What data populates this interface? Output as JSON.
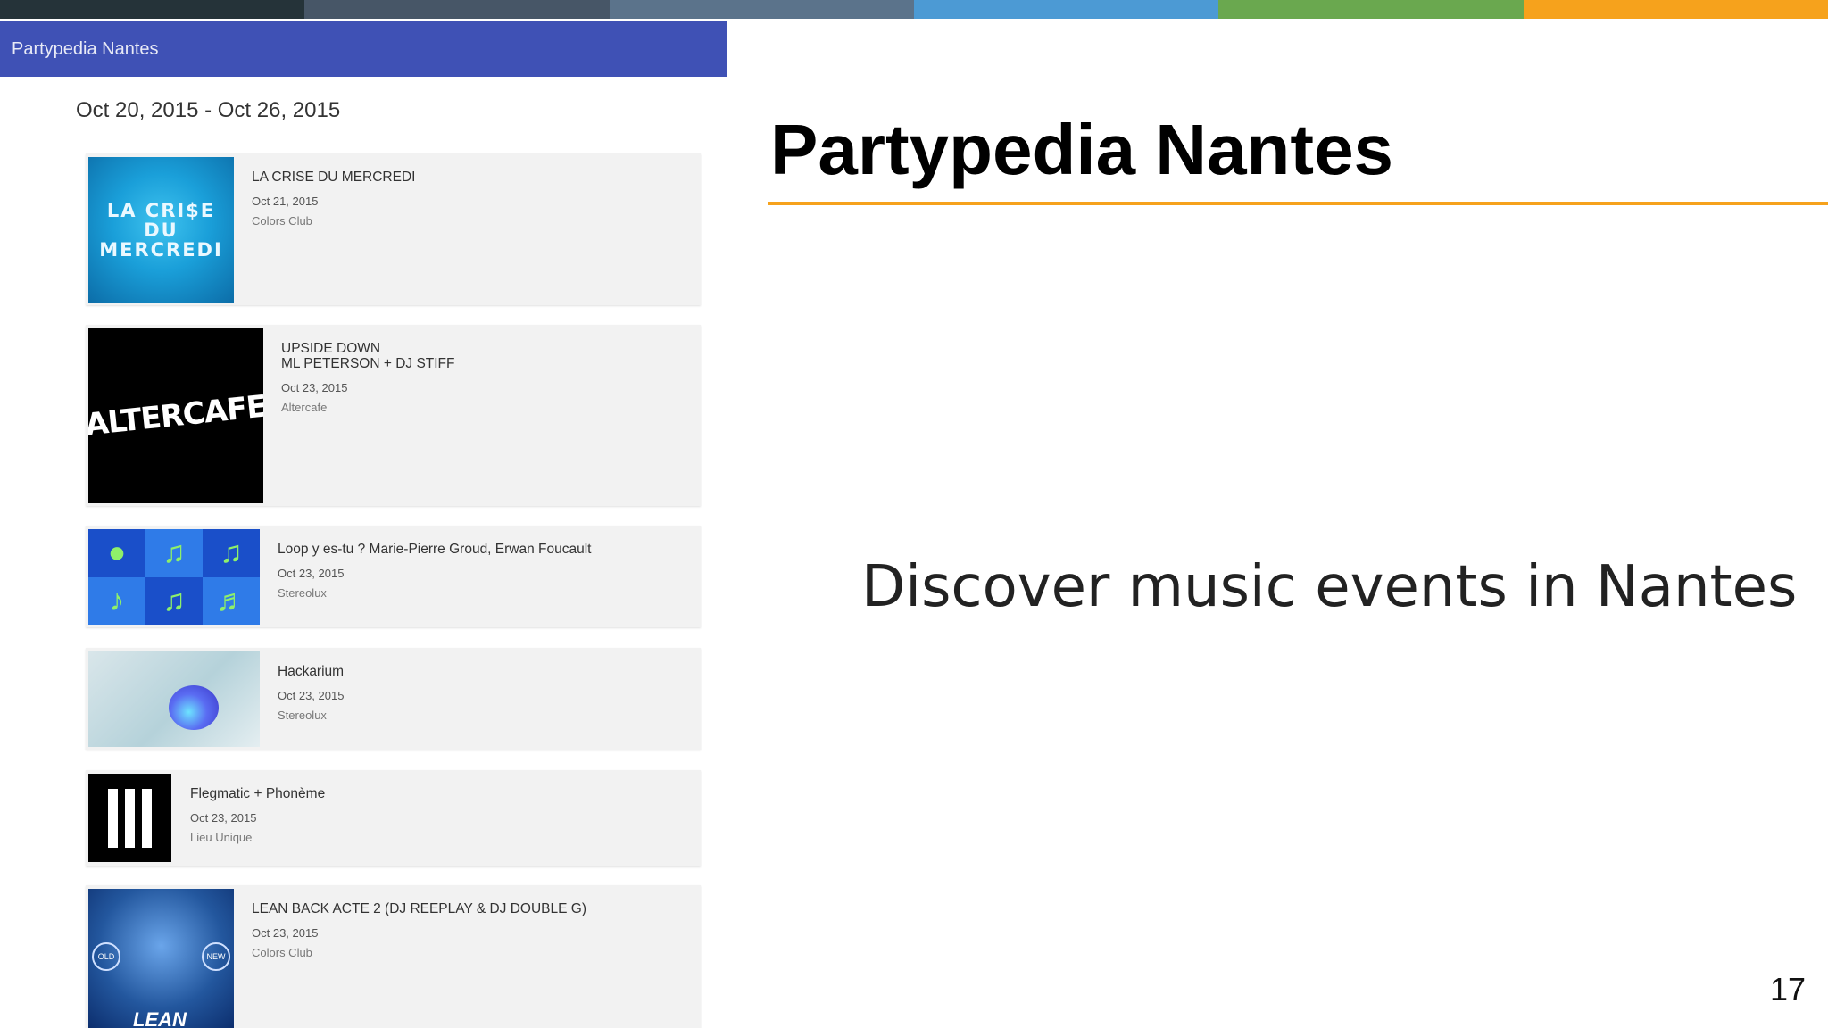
{
  "top_bar_colors": [
    "#253339",
    "#475667",
    "#5b738b",
    "#4c9ad4",
    "#6aa84f",
    "#f6a21c"
  ],
  "app": {
    "header_title": "Partypedia Nantes",
    "header_color": "#3f51b5",
    "date_range": "Oct 20, 2015 - Oct 26, 2015",
    "events": [
      {
        "title": "LA CRISE DU MERCREDI",
        "date": "Oct 21, 2015",
        "venue": "Colors Club",
        "thumb_text": "LA CRI$E DU\nMERCREDI",
        "icon": "crise-du-mercredi-poster"
      },
      {
        "title": "UPSIDE DOWN\nML PETERSON + DJ STIFF",
        "date": "Oct 23, 2015",
        "venue": "Altercafe",
        "thumb_text": "ALTERCAFE",
        "icon": "altercafe-logo"
      },
      {
        "title": "Loop y es-tu ? Marie-Pierre Groud, Erwan Foucault",
        "date": "Oct 23, 2015",
        "venue": "Stereolux",
        "icon": "music-notes-grid"
      },
      {
        "title": "Hackarium",
        "date": "Oct 23, 2015",
        "venue": "Stereolux",
        "icon": "hackarium-image"
      },
      {
        "title": "Flegmatic + Phonème",
        "date": "Oct 23, 2015",
        "venue": "Lieu Unique",
        "icon": "lieu-unique-logo"
      },
      {
        "title": "LEAN BACK ACTE 2 (DJ REEPLAY & DJ DOUBLE G)",
        "date": "Oct 23, 2015",
        "venue": "Colors Club",
        "thumb_text": "LEAN",
        "icon": "lean-back-poster"
      }
    ]
  },
  "slide": {
    "title": "Partypedia Nantes",
    "subtitle": "Discover music events in Nantes",
    "page_number": "17",
    "accent": "#f6a21c"
  }
}
